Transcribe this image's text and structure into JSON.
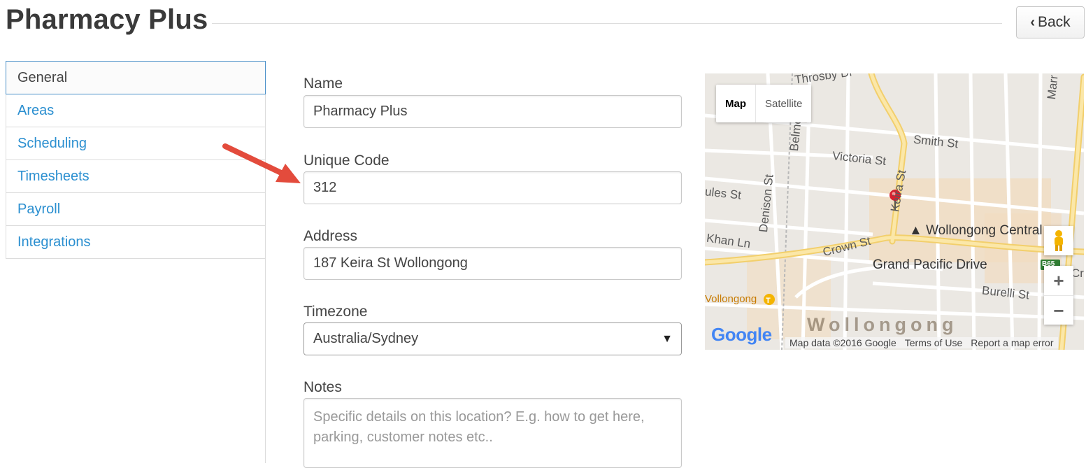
{
  "header": {
    "title": "Pharmacy Plus",
    "back_label": "Back"
  },
  "sidebar": {
    "items": [
      {
        "label": "General",
        "active": true
      },
      {
        "label": "Areas"
      },
      {
        "label": "Scheduling"
      },
      {
        "label": "Timesheets"
      },
      {
        "label": "Payroll"
      },
      {
        "label": "Integrations"
      }
    ]
  },
  "form": {
    "name": {
      "label": "Name",
      "value": "Pharmacy Plus"
    },
    "unique_code": {
      "label": "Unique Code",
      "value": "312"
    },
    "address": {
      "label": "Address",
      "value": "187 Keira St Wollongong"
    },
    "timezone": {
      "label": "Timezone",
      "value": "Australia/Sydney"
    },
    "notes": {
      "label": "Notes",
      "placeholder": "Specific details on this location? E.g. how to get here, parking, customer notes etc.."
    }
  },
  "map": {
    "type_buttons": [
      "Map",
      "Satellite"
    ],
    "labels": {
      "throsby": "Throsby Dr",
      "smith": "Smith St",
      "victoria": "Victoria St",
      "belmore": "Belmore St",
      "denison": "Denison St",
      "keira": "Keira St",
      "ules": "ules St",
      "khan": "Khan Ln",
      "crown": "Crown St",
      "central": "Wollongong Central",
      "grand_pacific": "Grand Pacific Drive",
      "burelli": "Burelli St",
      "station": "Vollongong",
      "city": "Wollongong",
      "marr": "Marr",
      "cr": "Cr",
      "route": "B65"
    },
    "logo": "Google",
    "footer": [
      "Map data ©2016 Google",
      "Terms of Use",
      "Report a map error"
    ],
    "zoom_in": "+",
    "zoom_out": "−"
  },
  "colors": {
    "link": "#2b8fd0",
    "active_border": "#4a90c8",
    "annotation_arrow": "#e34b3c",
    "map_major_road": "#f7d97a"
  },
  "icons": {
    "back": "chevron-left-icon",
    "select": "caret-down-icon",
    "marker": "map-pin-icon",
    "pegman": "street-view-icon"
  }
}
